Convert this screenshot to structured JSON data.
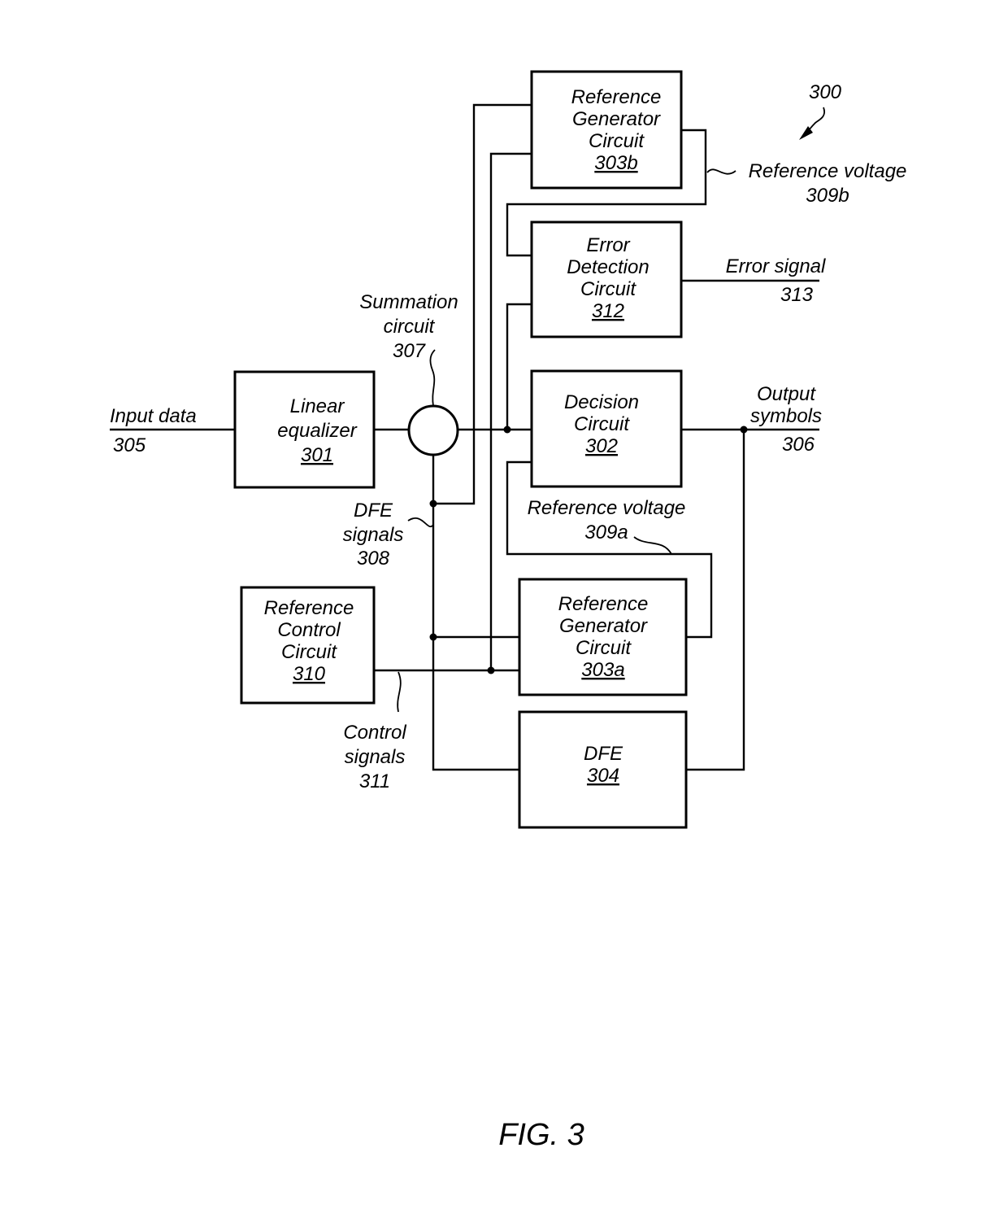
{
  "figure": {
    "caption": "FIG. 3",
    "reference_number": "300"
  },
  "blocks": {
    "linear_equalizer": {
      "lines": [
        "Linear",
        "equalizer"
      ],
      "ref": "301"
    },
    "decision_circuit": {
      "lines": [
        "Decision",
        "Circuit"
      ],
      "ref": "302"
    },
    "ref_gen_a": {
      "lines": [
        "Reference",
        "Generator",
        "Circuit"
      ],
      "ref": "303a"
    },
    "ref_gen_b": {
      "lines": [
        "Reference",
        "Generator",
        "Circuit"
      ],
      "ref": "303b"
    },
    "dfe": {
      "lines": [
        "DFE"
      ],
      "ref": "304"
    },
    "ref_control": {
      "lines": [
        "Reference",
        "Control",
        "Circuit"
      ],
      "ref": "310"
    },
    "error_detection": {
      "lines": [
        "Error",
        "Detection",
        "Circuit"
      ],
      "ref": "312"
    }
  },
  "signals": {
    "input_data": {
      "lines": [
        "Input data"
      ],
      "ref": "305"
    },
    "output_symbols": {
      "lines": [
        "Output",
        "symbols"
      ],
      "ref": "306"
    },
    "summation": {
      "lines": [
        "Summation",
        "circuit"
      ],
      "ref": "307"
    },
    "dfe_signals": {
      "lines": [
        "DFE",
        "signals"
      ],
      "ref": "308"
    },
    "ref_voltage_a": {
      "lines": [
        "Reference voltage"
      ],
      "ref": "309a"
    },
    "ref_voltage_b": {
      "lines": [
        "Reference voltage"
      ],
      "ref": "309b"
    },
    "control_signals": {
      "lines": [
        "Control",
        "signals"
      ],
      "ref": "311"
    },
    "error_signal": {
      "lines": [
        "Error signal"
      ],
      "ref": "313"
    }
  }
}
